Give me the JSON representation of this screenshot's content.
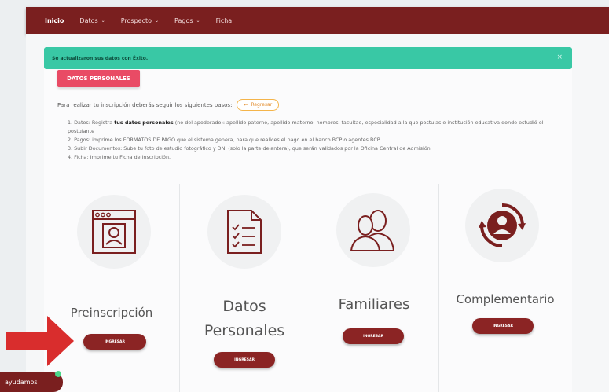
{
  "nav": {
    "items": [
      {
        "label": "Inicio",
        "dropdown": false
      },
      {
        "label": "Datos",
        "dropdown": true
      },
      {
        "label": "Prospecto",
        "dropdown": true
      },
      {
        "label": "Pagos",
        "dropdown": true
      },
      {
        "label": "Ficha",
        "dropdown": false
      }
    ],
    "caret": "⌄"
  },
  "alert": {
    "text": "Se actualizaron sus datos con Éxito.",
    "close": "×"
  },
  "section_tag": "DATOS PERSONALES",
  "intro": {
    "text": "Para realizar tu inscripción deberás seguir los siguientes pasos:",
    "back_button": "Regresar",
    "back_icon": "←"
  },
  "steps": {
    "s1_pre": "1. Datos: Registra ",
    "s1_bold": "tus datos personales",
    "s1_post": " (no del apoderado): apellido paterno, apellido materno, nombres, facultad, especialidad a la que postulas e institución educativa donde estudió el postulante",
    "s2": "2. Pagos: imprime los FORMATOS DE PAGO que el sistema genera, para que realices el pago en el banco BCP o agentes BCP.",
    "s3": "3. Subir Documentos: Sube tu foto de estudio fotográfico y DNI (solo la parte delantera), que serán validados por la Oficina Central de Admisión.",
    "s4": "4. Ficha: Imprime tu Ficha de inscripción."
  },
  "cards": [
    {
      "title": "Preinscripción",
      "button": "INGRESAR"
    },
    {
      "title_line1": "Datos",
      "title_line2": "Personales",
      "button": "INGRESAR"
    },
    {
      "title": "Familiares",
      "button": "INGRESAR"
    },
    {
      "title": "Complementario",
      "button": "INGRESAR"
    }
  ],
  "help_button": "ayudamos",
  "colors": {
    "brand": "#7a1f1f",
    "accent_pink": "#e94b65",
    "alert_green": "#39c8a5",
    "arrow_red": "#d92d2d"
  }
}
